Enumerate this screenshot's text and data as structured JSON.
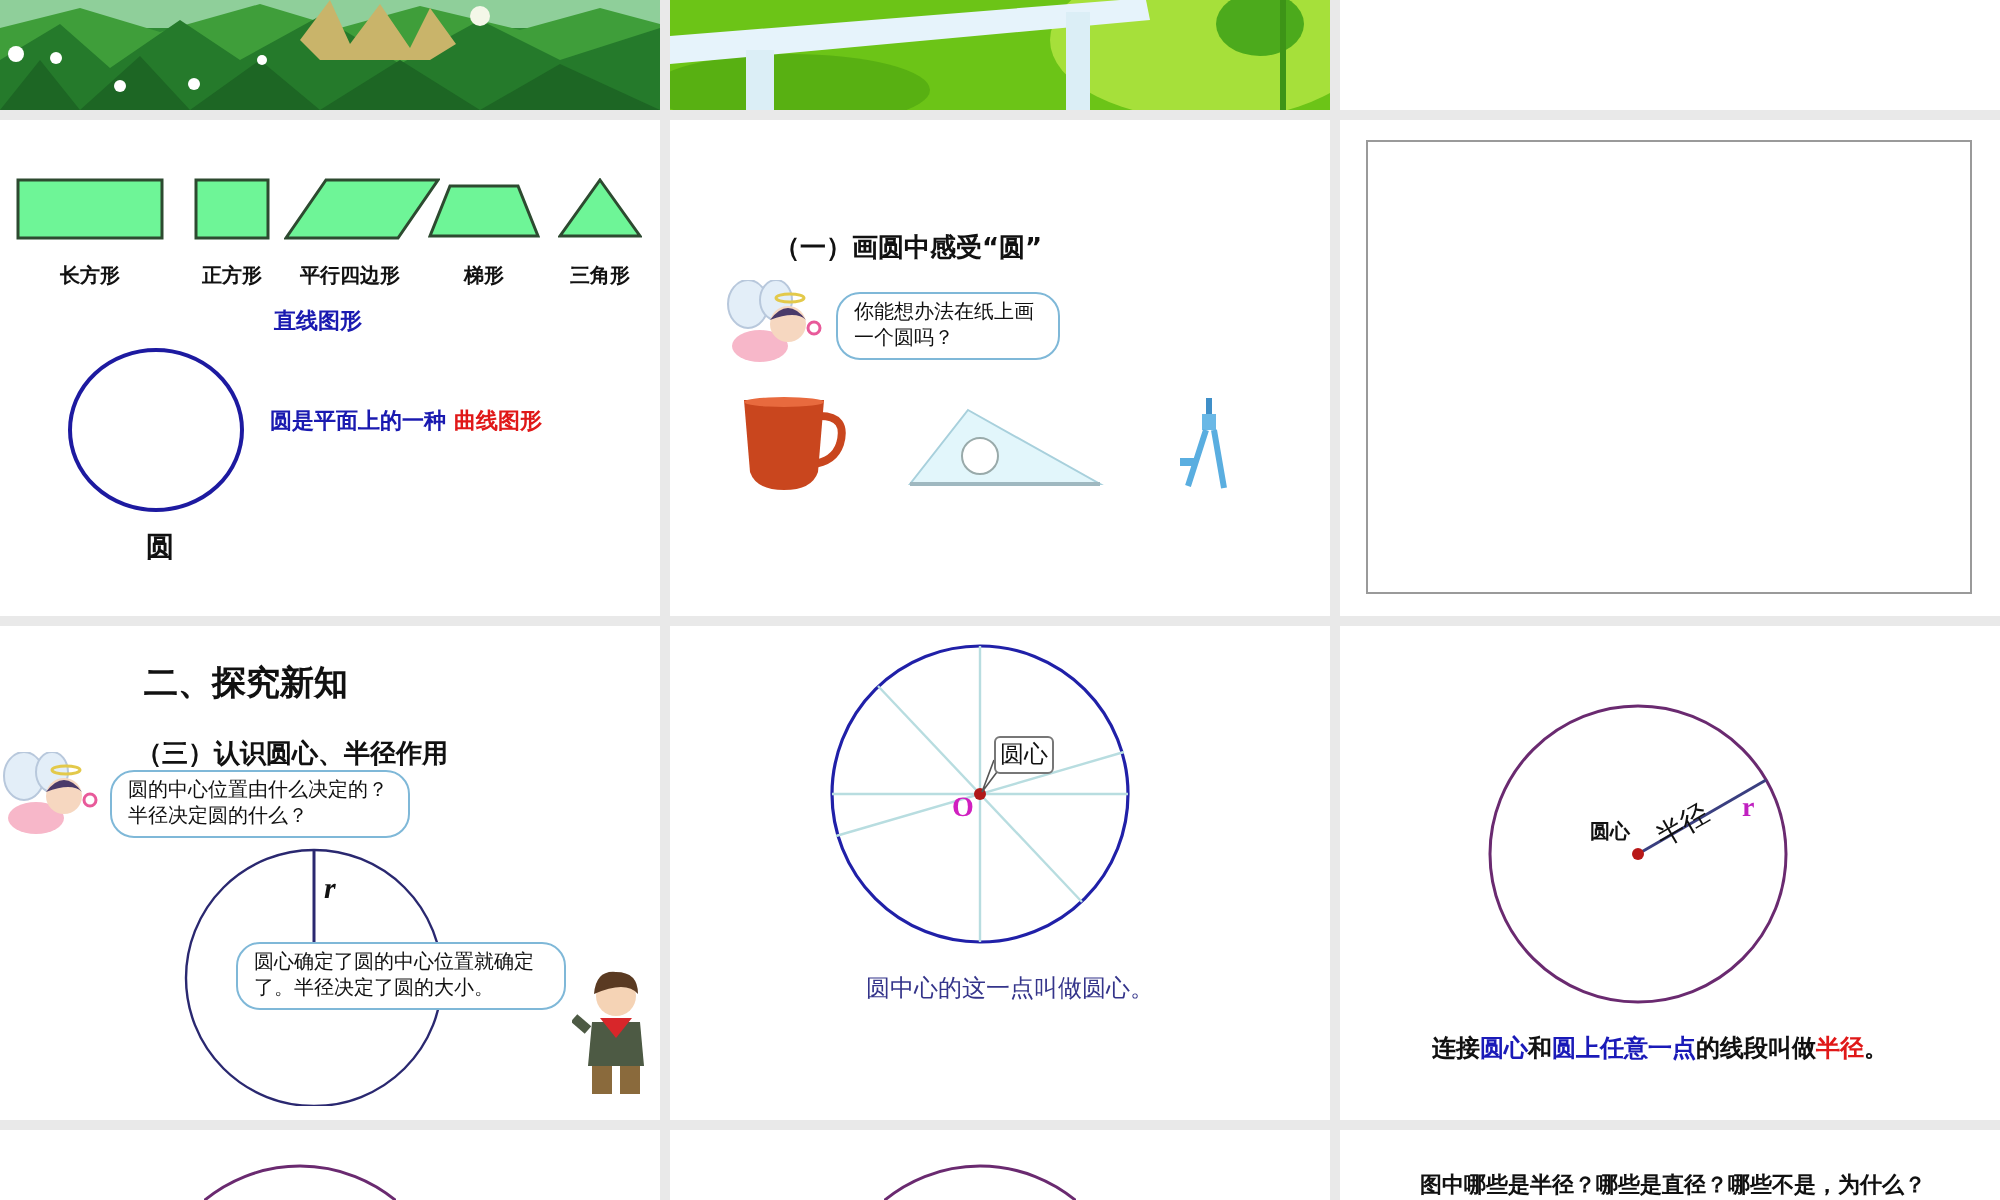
{
  "slides": [
    {
      "kind": "picture"
    },
    {
      "kind": "picture"
    },
    {
      "kind": "blank"
    },
    {
      "kind": "shapes",
      "shapes": [
        {
          "kind": "rectangle",
          "label": "长方形"
        },
        {
          "kind": "square",
          "label": "正方形"
        },
        {
          "kind": "parallelogram",
          "label": "平行四边形"
        },
        {
          "kind": "trapezoid",
          "label": "梯形"
        },
        {
          "kind": "triangle",
          "label": "三角形"
        }
      ],
      "caption": "直线图形",
      "statement": "圆是平面上的一种",
      "highlight": "曲线图形",
      "circle_label": "圆"
    },
    {
      "kind": "tools",
      "title": "（一）画圆中感受“圆”",
      "bubble": "你能想办法在纸上画一个圆吗？"
    },
    {
      "kind": "frame"
    },
    {
      "kind": "intro",
      "heading": "二、探究新知",
      "subheading": "（三）认识圆心、半径作用",
      "question": "圆的中心位置由什么决定的？半径决定圆的什么？",
      "answer": "圆心确定了圆的中心位置就确定了。半径决定了圆的大小。",
      "radius_letter": "r"
    },
    {
      "kind": "center",
      "callout": "圆心",
      "point": "O",
      "caption": "圆中心的这一点叫做圆心。"
    },
    {
      "kind": "radius",
      "center_label": "圆心",
      "radius_label": "半径",
      "radius_letter": "r",
      "caption": [
        {
          "text": "连接",
          "color": "#111111"
        },
        {
          "text": "圆心",
          "color": "#1a1ab8"
        },
        {
          "text": "和",
          "color": "#111111"
        },
        {
          "text": "圆上任意一点",
          "color": "#1a1ab8"
        },
        {
          "text": "的线段叫做",
          "color": "#111111"
        },
        {
          "text": "半径",
          "color": "#e01818"
        },
        {
          "text": "。",
          "color": "#111111"
        }
      ]
    },
    {
      "kind": "arc"
    },
    {
      "kind": "arc"
    },
    {
      "kind": "question",
      "text": "图中哪些是半径？哪些是直径？哪些不是，为什么？"
    }
  ]
}
